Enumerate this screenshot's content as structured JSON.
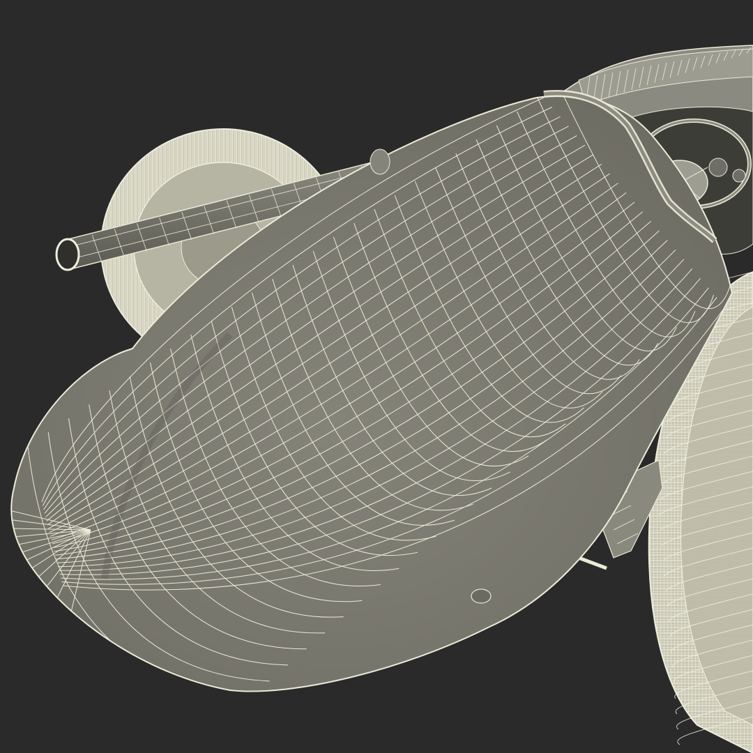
{
  "scene": {
    "subject": "wireframe-race-car-nose",
    "colors": {
      "background": "#2a2a2a",
      "body_fill": "#7f7e74",
      "body_shadow": "#6e6d64",
      "wire": "#ecebd8",
      "tire": "#d9d7c4",
      "tire_dark": "#a9a796",
      "pipe": "#74736a",
      "cockpit_dark": "#3a3a36"
    }
  }
}
